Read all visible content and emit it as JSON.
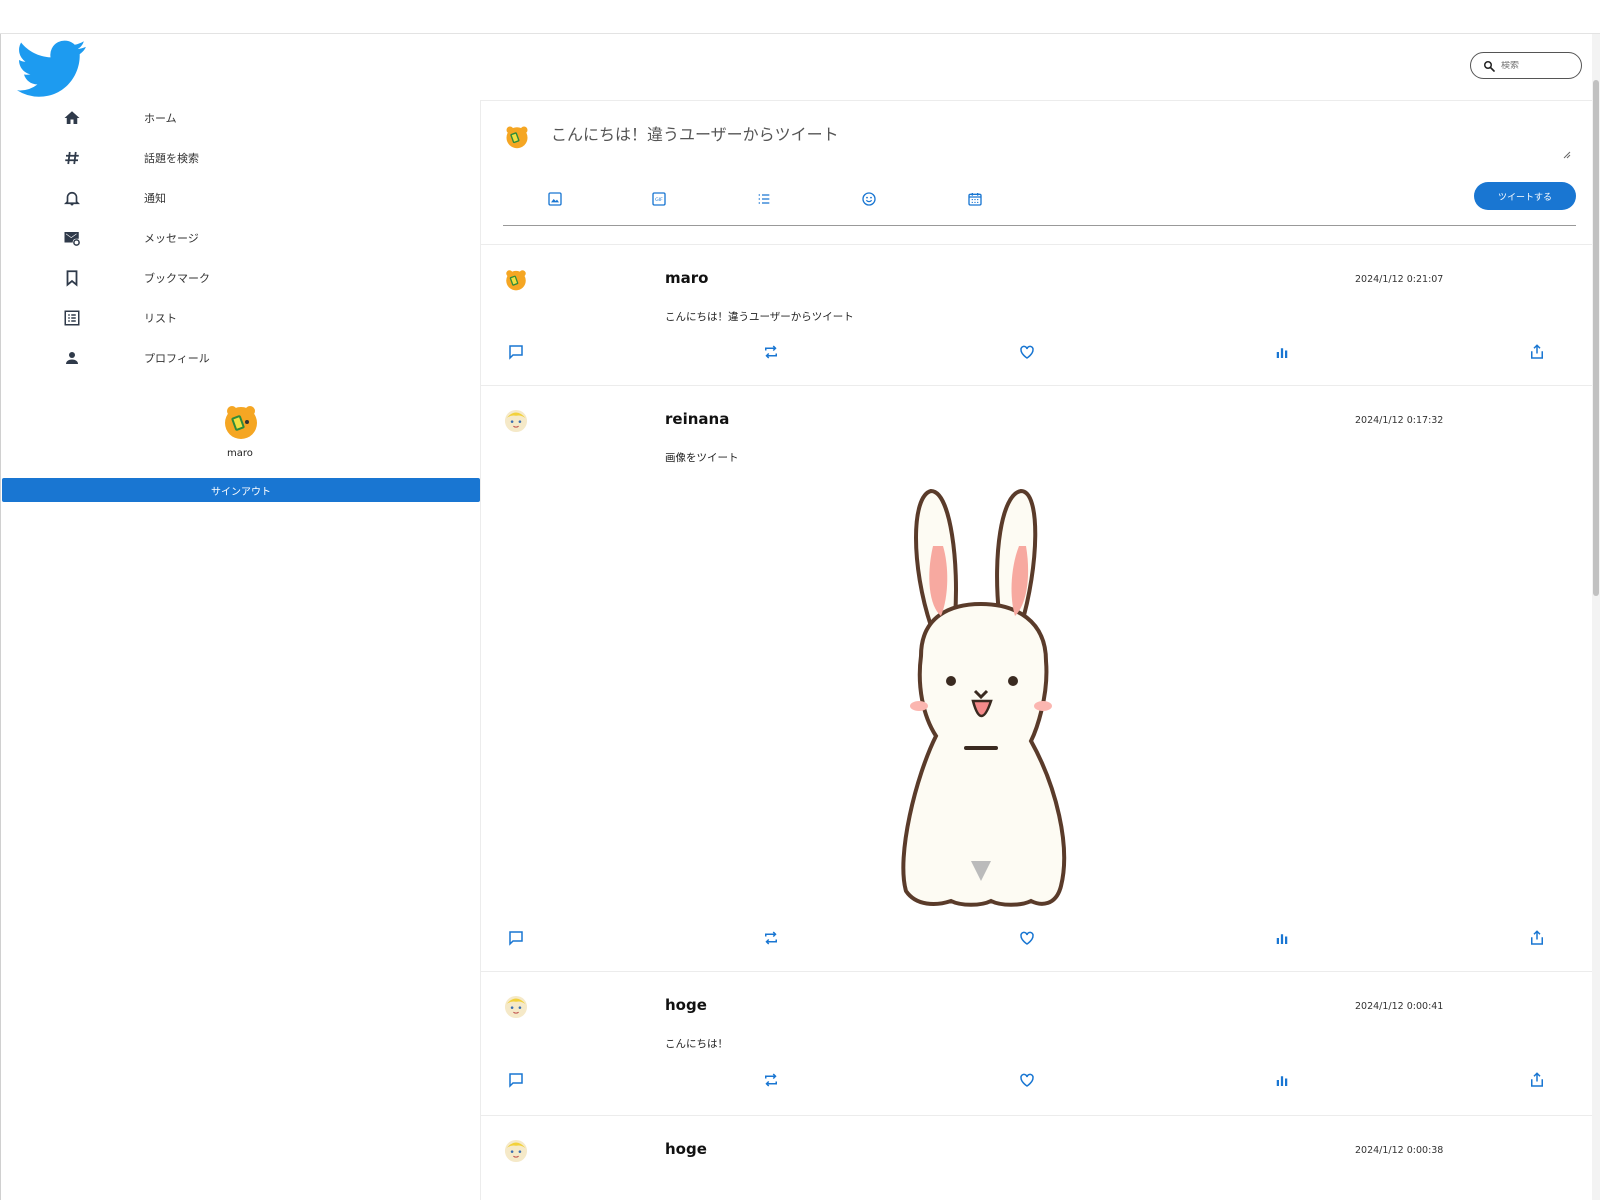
{
  "search": {
    "placeholder": "検索"
  },
  "sidebar": {
    "items": [
      {
        "label": "ホーム",
        "icon": "home-icon"
      },
      {
        "label": "話題を検索",
        "icon": "hashtag-icon"
      },
      {
        "label": "通知",
        "icon": "bell-icon"
      },
      {
        "label": "メッセージ",
        "icon": "mail-icon"
      },
      {
        "label": "ブックマーク",
        "icon": "bookmark-icon"
      },
      {
        "label": "リスト",
        "icon": "list-icon"
      },
      {
        "label": "プロフィール",
        "icon": "person-icon"
      }
    ],
    "profile": {
      "name": "maro"
    },
    "signout_label": "サインアウト"
  },
  "compose": {
    "text": "こんにちは！違うユーザーからツイート",
    "tweet_button": "ツイートする",
    "tools": [
      "image-icon",
      "gif-icon",
      "list-icon",
      "emoji-icon",
      "calendar-icon"
    ]
  },
  "tweets": [
    {
      "user": "maro",
      "time": "2024/1/12 0:21:07",
      "text": "こんにちは！違うユーザーからツイート"
    },
    {
      "user": "reinana",
      "time": "2024/1/12 0:17:32",
      "text": "画像をツイート",
      "image": "rabbit-illustration"
    },
    {
      "user": "hoge",
      "time": "2024/1/12 0:00:41",
      "text": "こんにちは！"
    },
    {
      "user": "hoge",
      "time": "2024/1/12 0:00:38",
      "text": ""
    }
  ],
  "colors": {
    "accent": "#1976d2",
    "twitter_blue": "#1d9bf0",
    "icon_dark": "#2f3a4a"
  }
}
